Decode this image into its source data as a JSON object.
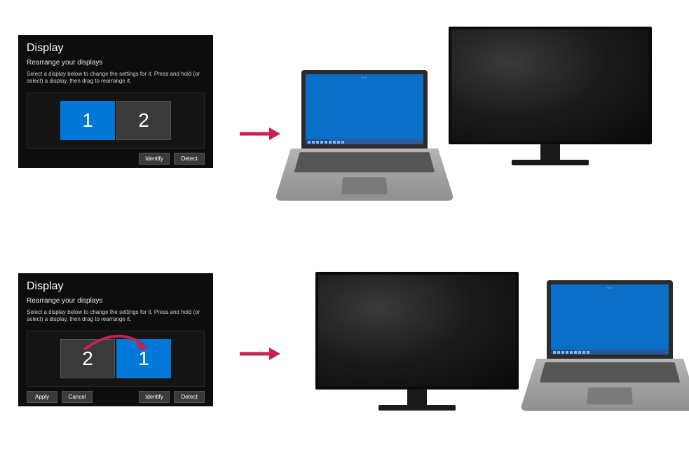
{
  "panel_top": {
    "title": "Display",
    "subtitle": "Rearrange your displays",
    "description": "Select a display below to change the settings for it. Press and hold (or select) a display, then drag to rearrange it.",
    "display_left_num": "1",
    "display_right_num": "2",
    "identify_label": "Identify",
    "detect_label": "Detect"
  },
  "panel_bottom": {
    "title": "Display",
    "subtitle": "Rearrange your displays",
    "description": "Select a display below to change the settings for it. Press and hold (or select) a display, then drag to rearrange it.",
    "display_left_num": "2",
    "display_right_num": "1",
    "apply_label": "Apply",
    "cancel_label": "Cancel",
    "identify_label": "Identify",
    "detect_label": "Detect"
  },
  "colors": {
    "arrow": "#c8224b",
    "selected_display": "#0078d7",
    "laptop_screen": "#0b6fc7"
  }
}
